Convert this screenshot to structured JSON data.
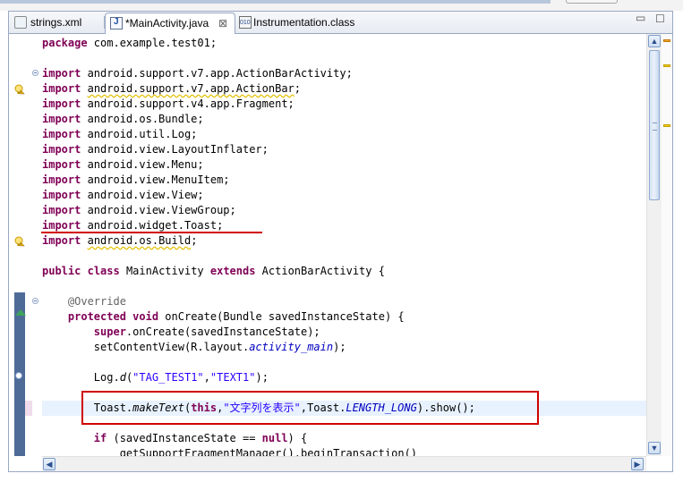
{
  "tabs": [
    {
      "label": "strings.xml",
      "icon": "xml-file-icon",
      "active": false
    },
    {
      "label": "*MainActivity.java",
      "icon": "java-file-icon",
      "active": true
    },
    {
      "label": "Instrumentation.class",
      "icon": "class-file-icon",
      "active": false
    }
  ],
  "tab_close_glyph": "⊠",
  "window_controls": {
    "minimize": "▭",
    "maximize": "☐"
  },
  "code_lines": [
    [
      {
        "t": "package",
        "c": "kw"
      },
      {
        "t": " com.example.test01;"
      }
    ],
    [],
    [
      {
        "t": "import",
        "c": "kw"
      },
      {
        "t": " android.support.v7.app.ActionBarActivity;"
      }
    ],
    [
      {
        "t": "import",
        "c": "kw"
      },
      {
        "t": " "
      },
      {
        "t": "android.support.v7.app.ActionBar",
        "c": "warn-u"
      },
      {
        "t": ";"
      }
    ],
    [
      {
        "t": "import",
        "c": "kw"
      },
      {
        "t": " android.support.v4.app.Fragment;"
      }
    ],
    [
      {
        "t": "import",
        "c": "kw"
      },
      {
        "t": " android.os.Bundle;"
      }
    ],
    [
      {
        "t": "import",
        "c": "kw"
      },
      {
        "t": " android.util.Log;"
      }
    ],
    [
      {
        "t": "import",
        "c": "kw"
      },
      {
        "t": " android.view.LayoutInflater;"
      }
    ],
    [
      {
        "t": "import",
        "c": "kw"
      },
      {
        "t": " android.view.Menu;"
      }
    ],
    [
      {
        "t": "import",
        "c": "kw"
      },
      {
        "t": " android.view.MenuItem;"
      }
    ],
    [
      {
        "t": "import",
        "c": "kw"
      },
      {
        "t": " android.view.View;"
      }
    ],
    [
      {
        "t": "import",
        "c": "kw"
      },
      {
        "t": " android.view.ViewGroup;"
      }
    ],
    [
      {
        "t": "import",
        "c": "kw"
      },
      {
        "t": " android.widget.Toast;"
      }
    ],
    [
      {
        "t": "import",
        "c": "kw"
      },
      {
        "t": " "
      },
      {
        "t": "android.os.Build",
        "c": "warn-u"
      },
      {
        "t": ";"
      }
    ],
    [],
    [
      {
        "t": "public",
        "c": "kw"
      },
      {
        "t": " "
      },
      {
        "t": "class",
        "c": "kw"
      },
      {
        "t": " MainActivity "
      },
      {
        "t": "extends",
        "c": "kw"
      },
      {
        "t": " ActionBarActivity {"
      }
    ],
    [],
    [
      {
        "t": "    "
      },
      {
        "t": "@Override",
        "c": "ann"
      }
    ],
    [
      {
        "t": "    "
      },
      {
        "t": "protected",
        "c": "kw"
      },
      {
        "t": " "
      },
      {
        "t": "void",
        "c": "kw"
      },
      {
        "t": " onCreate(Bundle savedInstanceState) {"
      }
    ],
    [
      {
        "t": "        "
      },
      {
        "t": "super",
        "c": "kw"
      },
      {
        "t": ".onCreate(savedInstanceState);"
      }
    ],
    [
      {
        "t": "        setContentView(R.layout."
      },
      {
        "t": "activity_main",
        "c": "field"
      },
      {
        "t": ");"
      }
    ],
    [],
    [
      {
        "t": "        Log."
      },
      {
        "t": "d",
        "c": "st-i"
      },
      {
        "t": "("
      },
      {
        "t": "\"TAG_TEST1\"",
        "c": "str"
      },
      {
        "t": ","
      },
      {
        "t": "\"TEXT1\"",
        "c": "str"
      },
      {
        "t": ");"
      }
    ],
    [],
    [
      {
        "t": "        Toast."
      },
      {
        "t": "makeText",
        "c": "st-i"
      },
      {
        "t": "("
      },
      {
        "t": "this",
        "c": "kw"
      },
      {
        "t": ","
      },
      {
        "t": "\"文字列を表示\"",
        "c": "str"
      },
      {
        "t": ",Toast."
      },
      {
        "t": "LENGTH_LONG",
        "c": "field"
      },
      {
        "t": ").show();"
      }
    ],
    [],
    [
      {
        "t": "        "
      },
      {
        "t": "if",
        "c": "kw"
      },
      {
        "t": " (savedInstanceState == "
      },
      {
        "t": "null",
        "c": "kw"
      },
      {
        "t": ") {"
      }
    ],
    [
      {
        "t": "            getSupportFragmentManager().beginTransaction()"
      }
    ]
  ],
  "warning_lines": [
    3,
    13
  ],
  "fold_lines": [
    2,
    17
  ],
  "current_line": 24,
  "scroll": {
    "up": "▲",
    "down": "▼",
    "left": "◀",
    "right": "▶"
  },
  "colors": {
    "keyword": "#7f0055",
    "string": "#2a00ff",
    "field": "#0000c0",
    "annotation": "#646464",
    "highlight": "#d00000"
  }
}
